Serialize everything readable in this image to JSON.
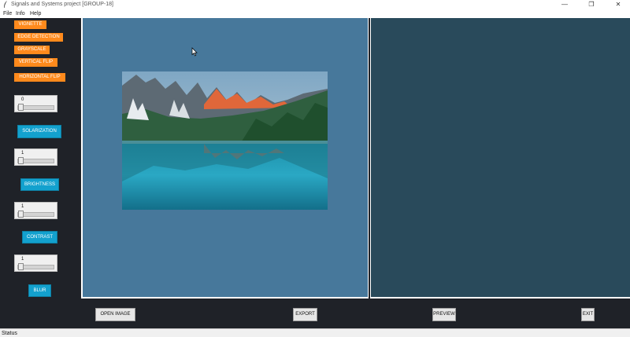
{
  "window": {
    "title": "Signals and Systems project [GROUP-18]",
    "minimize_glyph": "—",
    "restore_glyph": "❐",
    "close_glyph": "✕"
  },
  "menu": [
    "File",
    "Info",
    "Help"
  ],
  "sidebar": {
    "effect_buttons": [
      "VIGNETTE",
      "EDGE DETECTION",
      "GRAYSCALE",
      "VERTICAL FLIP",
      "HORIZONTAL FLIP"
    ],
    "controls": [
      {
        "slider_value": "0",
        "button_label": "SOLARIZATION"
      },
      {
        "slider_value": "1",
        "button_label": "BRIGHTNESS"
      },
      {
        "slider_value": "1",
        "button_label": "CONTRAST"
      },
      {
        "slider_value": "1",
        "button_label": "BLUR"
      }
    ]
  },
  "bottom_bar": {
    "open_label": "OPEN IMAGE",
    "export_label": "EXPORT",
    "preview_label": "PREVIEW",
    "exit_label": "EXIT"
  },
  "status": "Status",
  "colors": {
    "effect_button": "#ff8a1c",
    "control_button": "#13a1ce",
    "left_canvas": "#47789b",
    "right_canvas": "#294a5b",
    "app_background": "#1f2228"
  },
  "icons": {
    "app": "feather-icon",
    "cursor": "mouse-pointer-icon"
  }
}
